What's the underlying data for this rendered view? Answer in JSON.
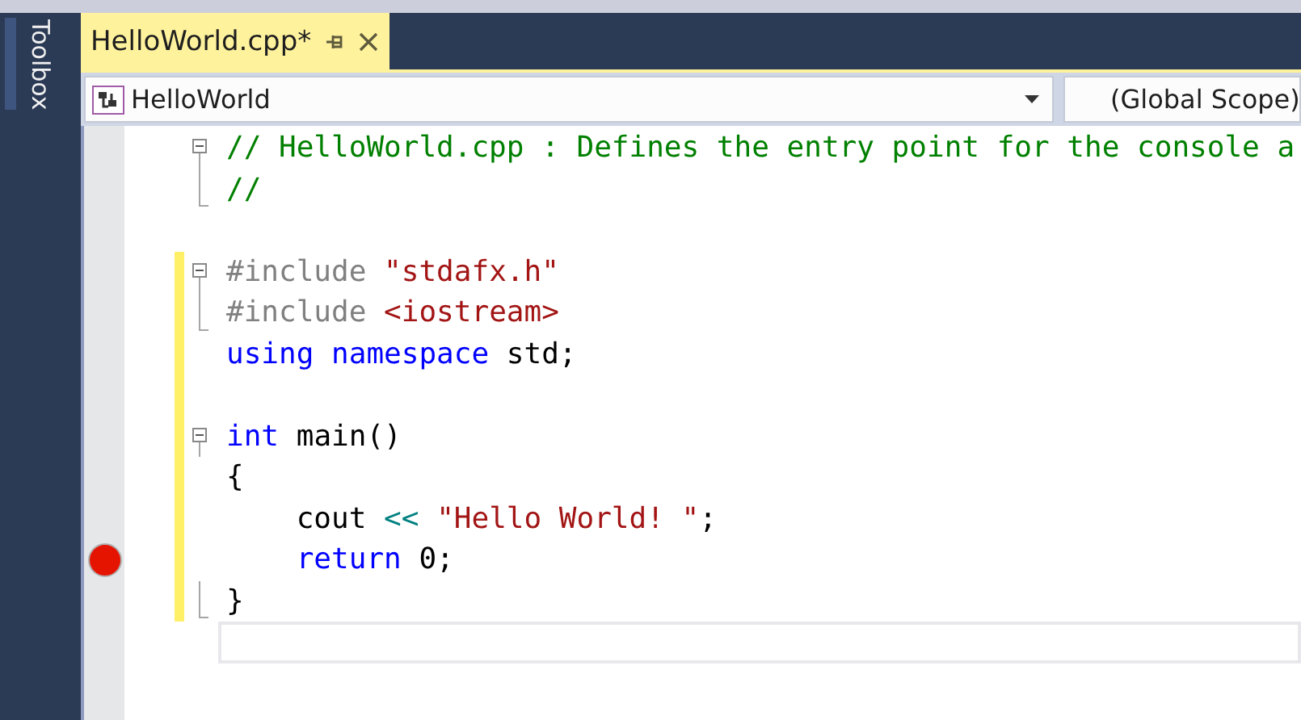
{
  "toolbox": {
    "label": "Toolbox"
  },
  "tabs": [
    {
      "label": "HelloWorld.cpp*",
      "selected": true
    }
  ],
  "navigation": {
    "project": "HelloWorld",
    "scope": "(Global Scope)"
  },
  "code": {
    "lines": [
      {
        "kind": "start",
        "changed": false,
        "breakpoint": false,
        "current": false,
        "tokens": [
          {
            "kind": "comment",
            "text": "// HelloWorld.cpp : Defines the entry point for the console a"
          }
        ]
      },
      {
        "kind": "end",
        "changed": false,
        "breakpoint": false,
        "current": false,
        "tokens": [
          {
            "kind": "comment",
            "text": "//"
          }
        ]
      },
      {
        "kind": "plain",
        "changed": false,
        "breakpoint": false,
        "current": false
      },
      {
        "kind": "start",
        "changed": true,
        "breakpoint": false,
        "current": false,
        "tokens": [
          {
            "kind": "preproc",
            "text": "#include "
          },
          {
            "kind": "string",
            "text": "\"stdafx.h\""
          }
        ]
      },
      {
        "kind": "end",
        "changed": true,
        "breakpoint": false,
        "current": false,
        "tokens": [
          {
            "kind": "preproc",
            "text": "#include "
          },
          {
            "kind": "string",
            "text": "<iostream>"
          }
        ]
      },
      {
        "kind": "plain",
        "changed": true,
        "breakpoint": false,
        "current": false,
        "tokens": [
          {
            "kind": "keyword",
            "text": "using namespace"
          },
          {
            "kind": "plain",
            "text": " std;"
          }
        ]
      },
      {
        "kind": "plain",
        "changed": true,
        "breakpoint": false,
        "current": false
      },
      {
        "kind": "start",
        "changed": true,
        "breakpoint": false,
        "current": false,
        "tokens": [
          {
            "kind": "keyword",
            "text": "int"
          },
          {
            "kind": "plain",
            "text": " main()"
          }
        ]
      },
      {
        "kind": "inner",
        "changed": true,
        "breakpoint": false,
        "current": false,
        "tokens": [
          {
            "kind": "plain",
            "text": "{"
          }
        ]
      },
      {
        "kind": "inner",
        "changed": true,
        "breakpoint": false,
        "current": false,
        "tokens": [
          {
            "kind": "plain",
            "text": "    cout "
          },
          {
            "kind": "operator",
            "text": "<< "
          },
          {
            "kind": "string",
            "text": "\"Hello World! \""
          },
          {
            "kind": "plain",
            "text": ";"
          }
        ]
      },
      {
        "kind": "inner",
        "changed": true,
        "breakpoint": true,
        "current": false,
        "tokens": [
          {
            "kind": "keyword",
            "text": "    return"
          },
          {
            "kind": "plain",
            "text": " 0;"
          }
        ]
      },
      {
        "kind": "end",
        "changed": true,
        "breakpoint": false,
        "current": false,
        "tokens": [
          {
            "kind": "plain",
            "text": "}"
          }
        ]
      },
      {
        "kind": "plain",
        "changed": false,
        "breakpoint": false,
        "current": true
      }
    ]
  }
}
